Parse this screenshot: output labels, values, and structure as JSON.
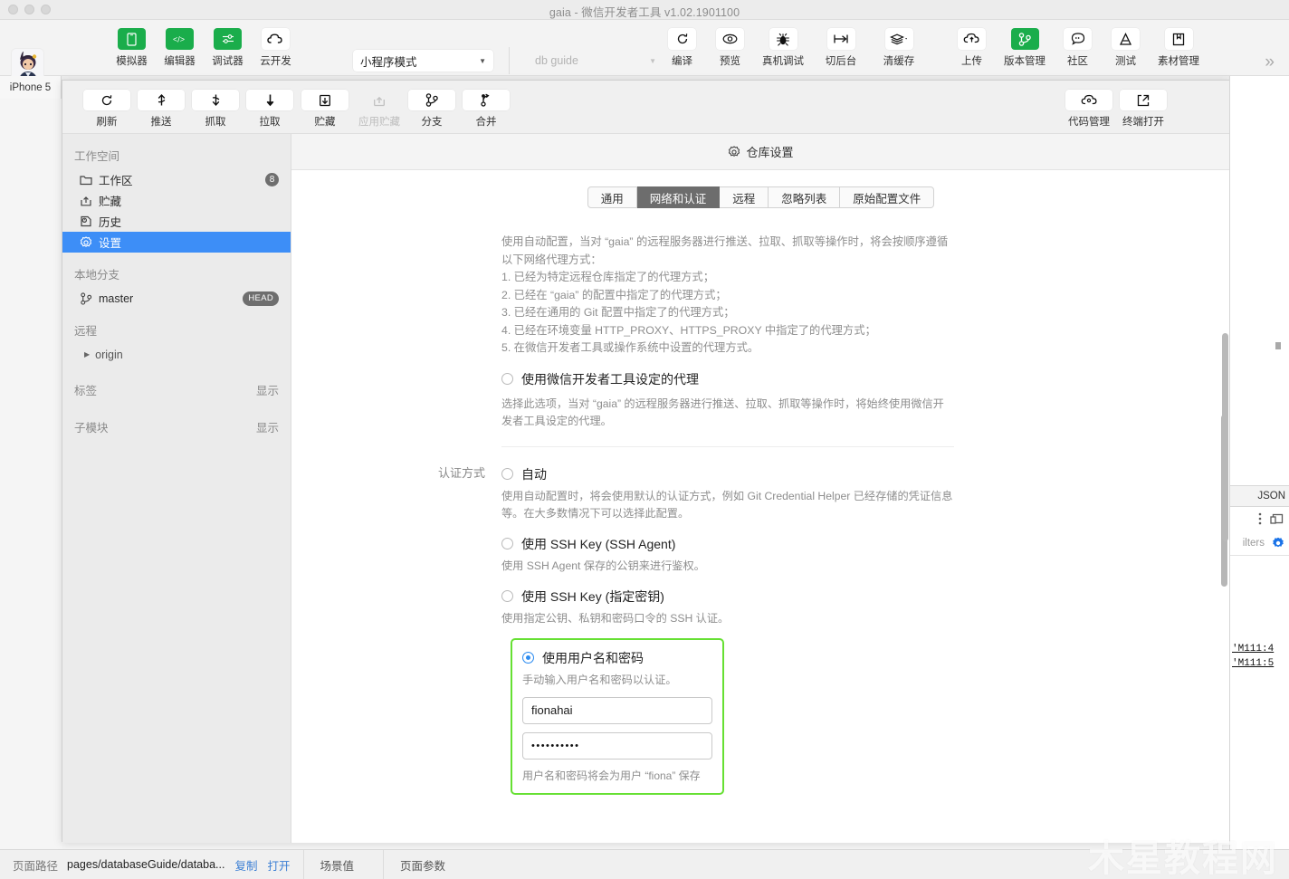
{
  "window": {
    "title": "gaia - 微信开发者工具 v1.02.1901100"
  },
  "toolbar": {
    "left_buttons": [
      {
        "label": "模拟器",
        "icon": "phone-icon",
        "style": "green"
      },
      {
        "label": "编辑器",
        "icon": "code-icon",
        "style": "green"
      },
      {
        "label": "调试器",
        "icon": "sliders-icon",
        "style": "green"
      },
      {
        "label": "云开发",
        "icon": "cloud-dev-icon",
        "style": "white"
      }
    ],
    "mode_select": {
      "value": "小程序模式",
      "icon": "chevron-down-icon"
    },
    "guide_select": {
      "placeholder": "db guide",
      "icon": "chevron-down-icon"
    },
    "right_buttons": [
      {
        "label": "编译",
        "icon": "refresh-icon",
        "style": "white"
      },
      {
        "label": "预览",
        "icon": "eye-icon",
        "style": "white"
      },
      {
        "label": "真机调试",
        "icon": "bug-icon",
        "style": "white"
      },
      {
        "label": "切后台",
        "icon": "background-icon",
        "style": "white"
      },
      {
        "label": "清缓存",
        "icon": "layers-icon",
        "style": "white"
      },
      {
        "label": "上传",
        "icon": "upload-cloud-icon",
        "style": "white"
      },
      {
        "label": "版本管理",
        "icon": "branch-icon",
        "style": "green"
      },
      {
        "label": "社区",
        "icon": "chat-icon",
        "style": "white"
      },
      {
        "label": "测试",
        "icon": "flask-icon",
        "style": "white"
      },
      {
        "label": "素材管理",
        "icon": "book-icon",
        "style": "white"
      }
    ],
    "overflow_icon": "chevron-double-right-icon"
  },
  "device_tab": {
    "label": "iPhone 5"
  },
  "git_toolbar": {
    "group1": [
      {
        "label": "刷新",
        "icon": "refresh-icon",
        "disabled": false
      },
      {
        "label": "推送",
        "icon": "push-icon",
        "disabled": false
      },
      {
        "label": "抓取",
        "icon": "fetch-icon",
        "disabled": false
      },
      {
        "label": "拉取",
        "icon": "pull-icon",
        "disabled": false
      }
    ],
    "group2": [
      {
        "label": "贮藏",
        "icon": "stash-icon",
        "disabled": false
      },
      {
        "label": "应用贮藏",
        "icon": "apply-stash-icon",
        "disabled": true
      }
    ],
    "group3": [
      {
        "label": "分支",
        "icon": "branch-icon",
        "disabled": false
      },
      {
        "label": "合并",
        "icon": "merge-icon",
        "disabled": false
      }
    ],
    "right": [
      {
        "label": "代码管理",
        "icon": "code-cloud-icon",
        "disabled": false
      },
      {
        "label": "终端打开",
        "icon": "external-link-icon",
        "disabled": false
      }
    ]
  },
  "sidebar": {
    "workspace_title": "工作空间",
    "workspace_items": [
      {
        "label": "工作区",
        "icon": "folder-icon",
        "badge": "8",
        "active": false
      },
      {
        "label": "贮藏",
        "icon": "stash-icon",
        "badge": "",
        "active": false
      },
      {
        "label": "历史",
        "icon": "history-icon",
        "badge": "",
        "active": false
      },
      {
        "label": "设置",
        "icon": "gear-icon",
        "badge": "",
        "active": true
      }
    ],
    "local_branch_title": "本地分支",
    "branch": {
      "label": "master",
      "icon": "branch-icon",
      "badge": "HEAD"
    },
    "remote_title": "远程",
    "remote_item": {
      "label": "origin",
      "icon": "triangle-right-icon"
    },
    "tags": {
      "label": "标签",
      "action": "显示"
    },
    "submodules": {
      "label": "子模块",
      "action": "显示"
    }
  },
  "main": {
    "header": {
      "title": "仓库设置",
      "icon": "gear-icon"
    },
    "tabs": [
      {
        "label": "通用",
        "selected": false
      },
      {
        "label": "网络和认证",
        "selected": true
      },
      {
        "label": "远程",
        "selected": false
      },
      {
        "label": "忽略列表",
        "selected": false
      },
      {
        "label": "原始配置文件",
        "selected": false
      }
    ],
    "intro_paragraph": "使用自动配置，当对 “gaia” 的远程服务器进行推送、拉取、抓取等操作时，将会按顺序遵循以下网络代理方式：",
    "intro_list": [
      "1. 已经为特定远程仓库指定了的代理方式；",
      "2. 已经在 “gaia” 的配置中指定了的代理方式；",
      "3. 已经在通用的 Git 配置中指定了的代理方式；",
      "4. 已经在环境变量 HTTP_PROXY、HTTPS_PROXY 中指定了的代理方式；",
      "5. 在微信开发者工具或操作系统中设置的代理方式。"
    ],
    "proxy_option": {
      "label": "使用微信开发者工具设定的代理",
      "selected": false,
      "desc": "选择此选项，当对 “gaia” 的远程服务器进行推送、拉取、抓取等操作时，将始终使用微信开发者工具设定的代理。"
    },
    "auth_section_label": "认证方式",
    "auth_options": [
      {
        "label": "自动",
        "selected": false,
        "desc": "使用自动配置时，将会使用默认的认证方式，例如 Git Credential Helper 已经存储的凭证信息等。在大多数情况下可以选择此配置。",
        "highlighted": false
      },
      {
        "label": "使用 SSH Key (SSH Agent)",
        "selected": false,
        "desc": "使用 SSH Agent 保存的公钥来进行鉴权。",
        "highlighted": false
      },
      {
        "label": "使用 SSH Key (指定密钥)",
        "selected": false,
        "desc": "使用指定公钥、私钥和密码口令的 SSH 认证。",
        "highlighted": false
      },
      {
        "label": "使用用户名和密码",
        "selected": true,
        "desc": "手动输入用户名和密码以认证。",
        "highlighted": true
      }
    ],
    "credentials": {
      "username_value": "fionahai",
      "password_value": "••••••••••",
      "save_note": "用户名和密码将会为用户 “fiona” 保存"
    }
  },
  "devtools": {
    "tab_json": "JSON",
    "icons": [
      "more-vertical-icon",
      "dock-icon",
      "gear-icon"
    ],
    "filters_text": "ilters",
    "log_lines": [
      "'M111:4",
      "'M111:5"
    ]
  },
  "statusbar": {
    "path_label": "页面路径",
    "path_value": "pages/databaseGuide/databa...",
    "copy_link": "复制",
    "open_link": "打开",
    "scene_cell": "场景值",
    "params_cell": "页面参数"
  },
  "watermark": {
    "text": "木星教程网"
  },
  "colors": {
    "accent_green": "#1aad4b",
    "selection_blue": "#3d8ef7",
    "radio_blue": "#2d8cf0",
    "highlight_green": "#66e033",
    "tab_selected": "#6d6d6d"
  }
}
